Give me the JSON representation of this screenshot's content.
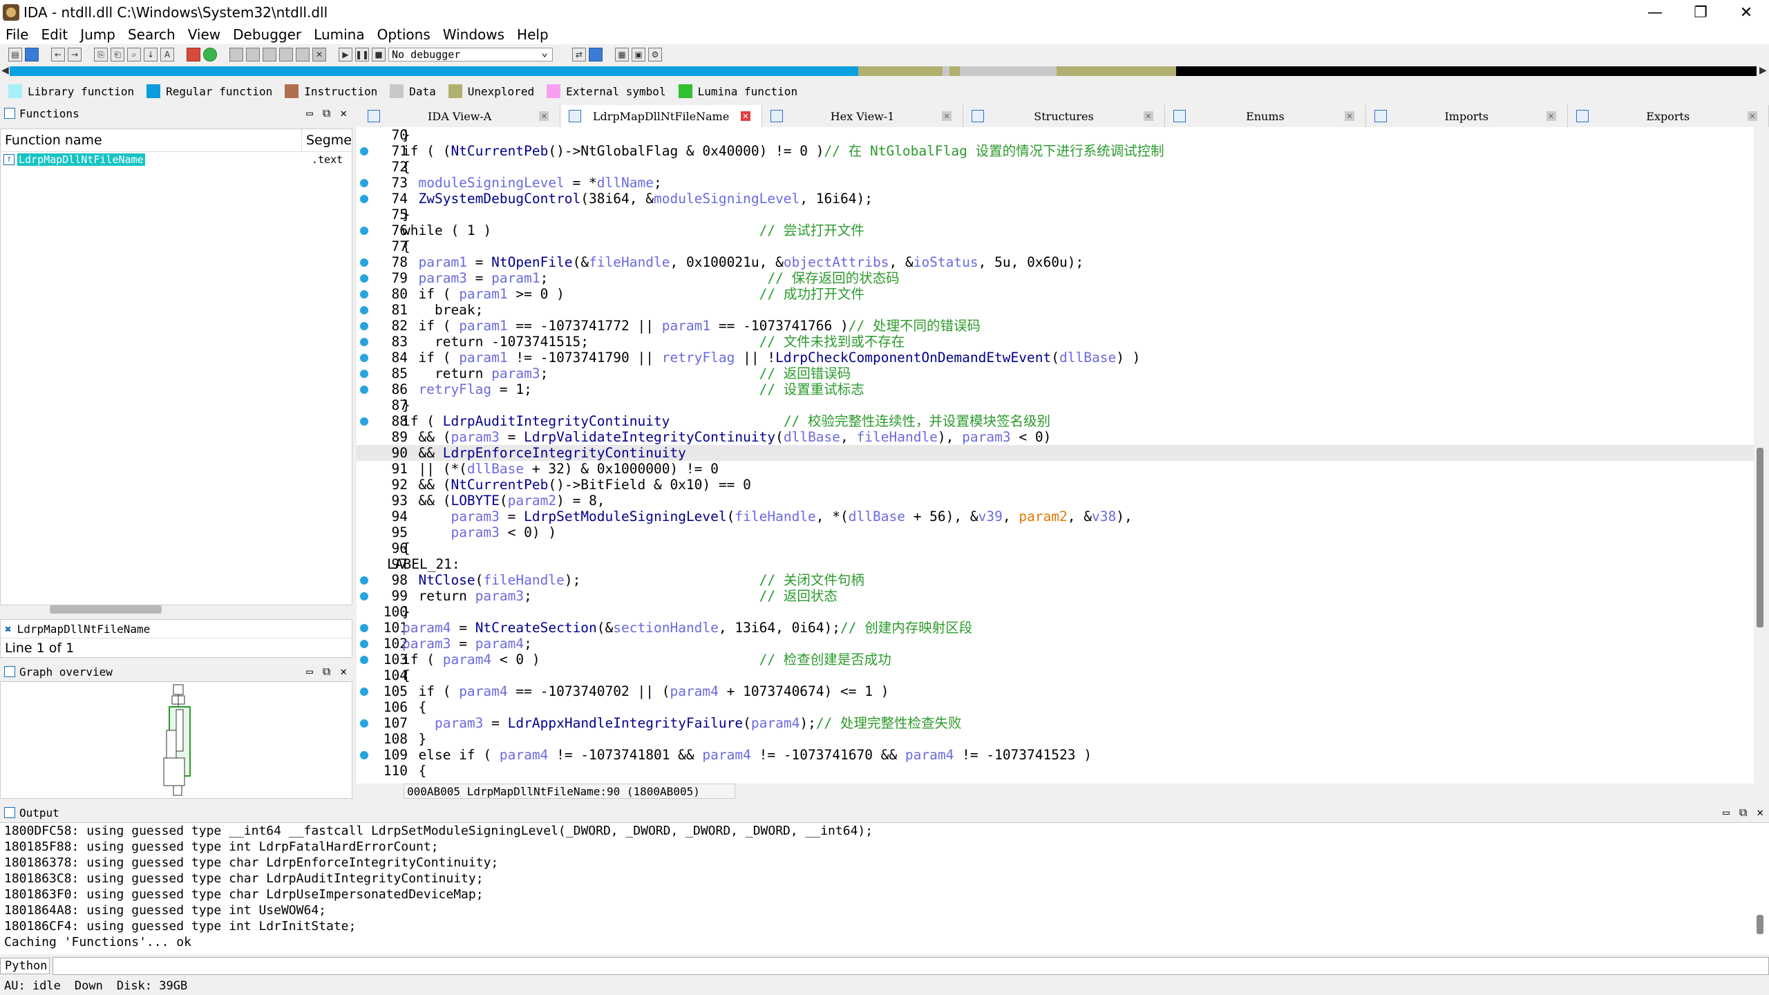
{
  "window": {
    "title": "IDA - ntdll.dll C:\\Windows\\System32\\ntdll.dll",
    "minimize": "—",
    "maximize": "❐",
    "close": "✕"
  },
  "menu": [
    "File",
    "Edit",
    "Jump",
    "Search",
    "View",
    "Debugger",
    "Lumina",
    "Options",
    "Windows",
    "Help"
  ],
  "toolbar": {
    "debugger_select": "No debugger"
  },
  "legend": [
    {
      "label": "Library function",
      "color": "#a8f0f8"
    },
    {
      "label": "Regular function",
      "color": "#0a9cdc"
    },
    {
      "label": "Instruction",
      "color": "#b07050"
    },
    {
      "label": "Data",
      "color": "#c8c8c8"
    },
    {
      "label": "Unexplored",
      "color": "#b0b070"
    },
    {
      "label": "External symbol",
      "color": "#f8a0f0"
    },
    {
      "label": "Lumina function",
      "color": "#30c030"
    }
  ],
  "functions_panel": {
    "title": "Functions",
    "col_name": "Function name",
    "col_segment": "Segme",
    "rows": [
      {
        "name": "LdrpMapDllNtFileName",
        "segment": ".text"
      }
    ],
    "current": "LdrpMapDllNtFileName",
    "line_info": "Line 1 of 1"
  },
  "graph_overview": {
    "title": "Graph overview"
  },
  "tabs": [
    {
      "label": "IDA View-A",
      "active": false
    },
    {
      "label": "LdrpMapDllNtFileName",
      "active": true
    },
    {
      "label": "Hex View-1",
      "active": false
    },
    {
      "label": "Structures",
      "active": false
    },
    {
      "label": "Enums",
      "active": false
    },
    {
      "label": "Imports",
      "active": false
    },
    {
      "label": "Exports",
      "active": false
    }
  ],
  "code_status": "000AB005 LdrpMapDllNtFileName:90 (1800AB005)",
  "output": {
    "title": "Output",
    "lines": [
      "1800DFC58: using guessed type __int64 __fastcall LdrpSetModuleSigningLevel(_DWORD, _DWORD, _DWORD, _DWORD, __int64);",
      "180185F88: using guessed type int LdrpFatalHardErrorCount;",
      "180186378: using guessed type char LdrpEnforceIntegrityContinuity;",
      "1801863C8: using guessed type char LdrpAuditIntegrityContinuity;",
      "1801863F0: using guessed type char LdrpUseImpersonatedDeviceMap;",
      "1801864A8: using guessed type int UseWOW64;",
      "180186CF4: using guessed type int LdrInitState;",
      "Caching 'Functions'... ok"
    ]
  },
  "python_button": "Python",
  "status_bar": [
    "AU:  idle",
    "Down",
    "Disk: 39GB"
  ]
}
